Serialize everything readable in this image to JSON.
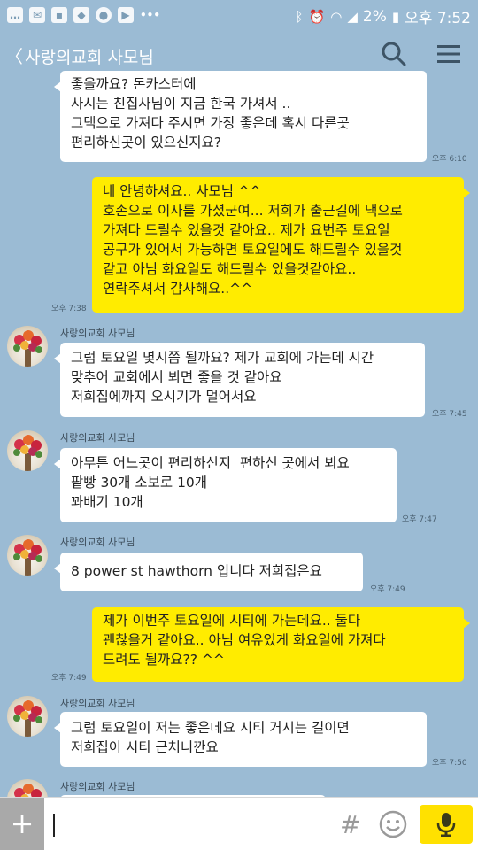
{
  "status_bar": {
    "left_icons": [
      "message-icon",
      "mail-icon",
      "gallery-icon",
      "maps-icon",
      "record-icon",
      "youtube-icon",
      "dots-icon"
    ],
    "battery": "2%",
    "time": "오후 7:52"
  },
  "header": {
    "back_glyph": "〈",
    "title": "사랑의교회 사모님"
  },
  "messages": [
    {
      "type": "received",
      "text": "좋을까요? 돈카스터에\n사시는 친집사님이 지금 한국 가셔서 ..\n그댁으로 가져다 주시면 가장 좋은데 혹시 다른곳\n편리하신곳이 있으신지요?",
      "time": "오후 6:10"
    },
    {
      "type": "sent",
      "text": "네 안녕하셔요.. 사모님 ^^\n호손으로 이사를 가셨군여... 저희가 출근길에 댁으로\n가져다 드릴수 있을것 같아요.. 제가 요번주 토요일\n공구가 있어서 가능하면 토요일에도 해드릴수 있을것\n같고 아님 화요일도 해드릴수 있을것같아요..\n연락주셔서 감사해요..^^",
      "time": "오후 7:38"
    },
    {
      "type": "received",
      "sender": "사랑의교회 사모님",
      "text": "그럼 토요일 몇시쯤 될까요? 제가 교회에 가는데 시간\n맞추어 교회에서 뵈면 좋을 것 같아요\n저희집에까지 오시기가 멀어서요",
      "time": "오후 7:45"
    },
    {
      "type": "received",
      "sender": "사랑의교회 사모님",
      "text": "아무튼 어느곳이 편리하신지  편하신 곳에서 뵈요\n팥빵 30개 소보로 10개\n꽈배기 10개",
      "time": "오후 7:47"
    },
    {
      "type": "received",
      "sender": "사랑의교회 사모님",
      "text": "8 power st hawthorn 입니다 저희집은요",
      "time": "오후 7:49"
    },
    {
      "type": "sent",
      "text": "제가 이번주 토요일에 시티에 가는데요.. 둘다\n괜찮을거 같아요.. 아님 여유있게 화요일에 가져다\n드려도 될까요?? ^^",
      "time": "오후 7:49"
    },
    {
      "type": "received",
      "sender": "사랑의교회 사모님",
      "text": "그럼 토요일이 저는 좋은데요 시티 거시는 길이면\n저희집이 시티 근처니깐요",
      "time": "오후 7:50"
    },
    {
      "type": "received",
      "sender": "사랑의교회 사모님",
      "text": "",
      "time": ""
    }
  ],
  "input_bar": {
    "plus_glyph": "+",
    "input_value": "",
    "hash_glyph": "#",
    "emoji_icon": "emoticon-icon",
    "send_icon": "mic-icon"
  },
  "colors": {
    "background": "#9bbbd4",
    "my_bubble": "#ffec00",
    "their_bubble": "#ffffff",
    "mic_button": "#ffe100"
  }
}
